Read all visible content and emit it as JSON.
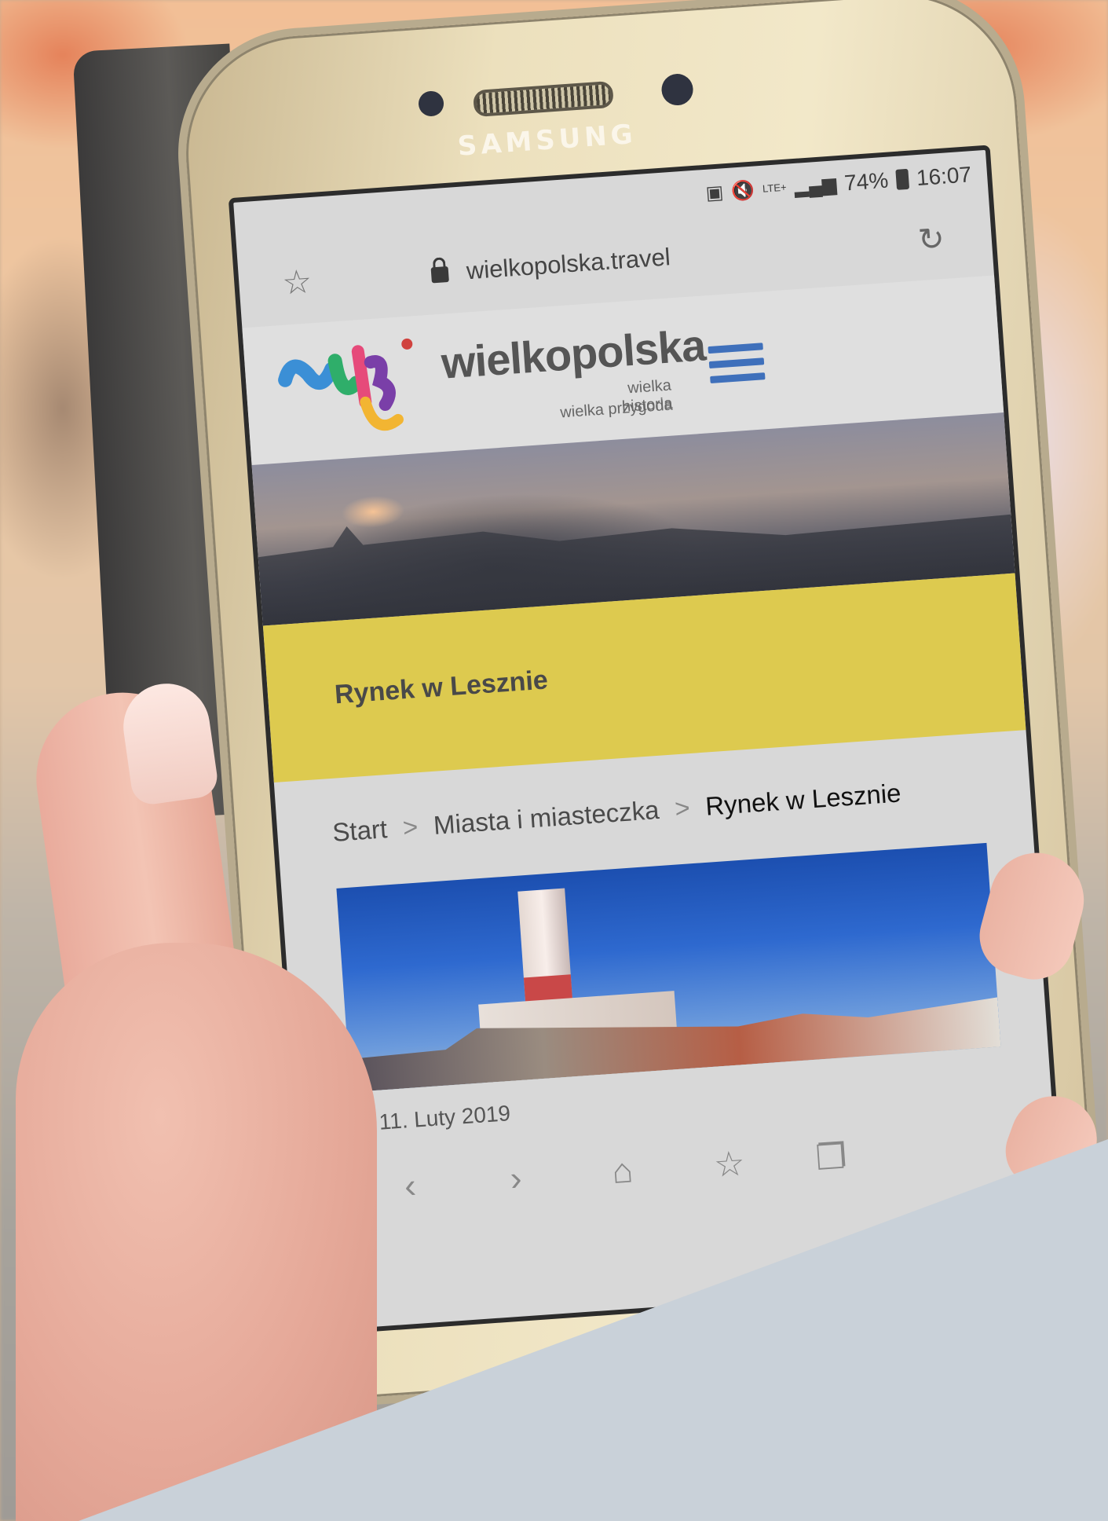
{
  "device": {
    "brand": "SAMSUNG"
  },
  "status_bar": {
    "network": "LTE+",
    "battery": "74%",
    "time": "16:07"
  },
  "browser": {
    "url": "wielkopolska.travel"
  },
  "site": {
    "name": "wielkopolska",
    "tagline_1": "wielka historia",
    "tagline_2": "wielka przygoda"
  },
  "page": {
    "title": "Rynek w Lesznie",
    "breadcrumb": [
      "Start",
      "Miasta i miasteczka",
      "Rynek w Lesznie"
    ],
    "breadcrumb_separator": ">",
    "date": "© 11. Luty 2019"
  },
  "icons": {
    "bookmark": "star-outline-icon",
    "reload": "reload-icon",
    "lock": "lock-icon",
    "menu": "hamburger-menu-icon",
    "back": "back-icon",
    "forward": "forward-icon",
    "home": "home-icon",
    "bookmarks": "bookmarks-icon",
    "tabs": "tabs-icon"
  },
  "colors": {
    "title_band": "#ddca4f",
    "menu_icon": "#3f70bb"
  }
}
